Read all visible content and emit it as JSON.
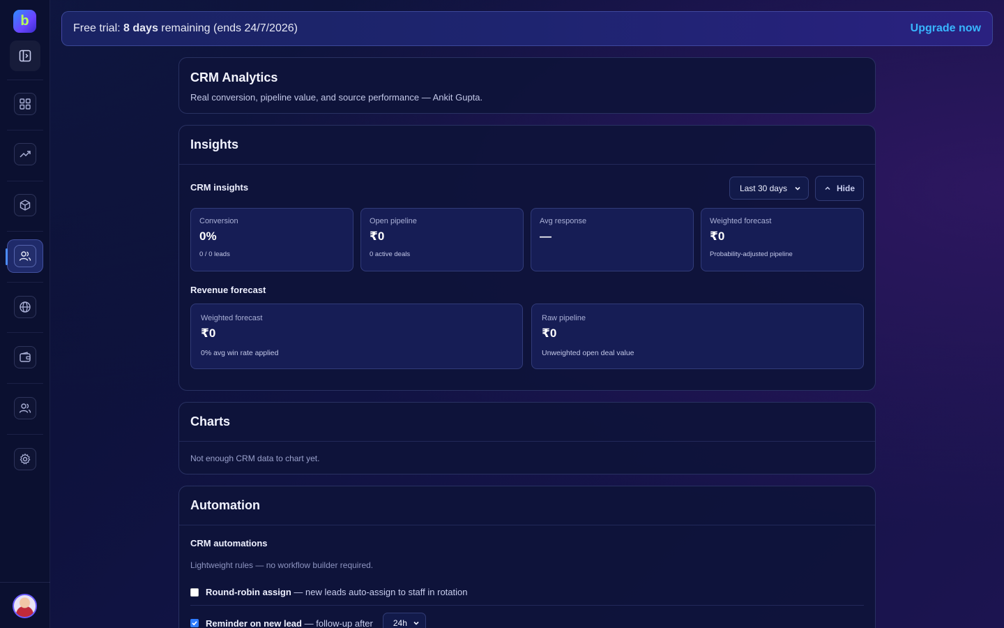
{
  "sidebar": {
    "logo_letter": "b",
    "items": [
      {
        "icon": "grid-icon"
      },
      {
        "icon": "trending-up-icon"
      },
      {
        "icon": "box-icon"
      },
      {
        "icon": "users-icon",
        "active": true
      },
      {
        "icon": "globe-icon"
      },
      {
        "icon": "wallet-icon"
      },
      {
        "icon": "team-icon"
      },
      {
        "icon": "gear-icon"
      }
    ]
  },
  "trial": {
    "prefix": "Free trial:",
    "days": "8 days",
    "suffix": "remaining (ends 24/7/2026)",
    "upgrade_label": "Upgrade now"
  },
  "header": {
    "title": "CRM Analytics",
    "subtitle": "Real conversion, pipeline value, and source performance — Ankit Gupta."
  },
  "insights": {
    "section_title": "Insights",
    "sub_title": "CRM insights",
    "range_select": "Last 30 days",
    "hide_label": "Hide",
    "stats": [
      {
        "label": "Conversion",
        "value": "0%",
        "note": "0 / 0 leads"
      },
      {
        "label": "Open pipeline",
        "value": "₹0",
        "note": "0 active deals"
      },
      {
        "label": "Avg response",
        "value": "—",
        "note": ""
      },
      {
        "label": "Weighted forecast",
        "value": "₹0",
        "note": "Probability-adjusted pipeline"
      }
    ],
    "revenue_title": "Revenue forecast",
    "revenue": [
      {
        "label": "Weighted forecast",
        "value": "₹0",
        "note": "0% avg win rate applied"
      },
      {
        "label": "Raw pipeline",
        "value": "₹0",
        "note": "Unweighted open deal value"
      }
    ]
  },
  "charts": {
    "section_title": "Charts",
    "empty_text": "Not enough CRM data to chart yet."
  },
  "automation": {
    "section_title": "Automation",
    "sub_title": "CRM automations",
    "description": "Lightweight rules — no workflow builder required.",
    "rules": [
      {
        "name": "Round-robin assign",
        "detail": "— new leads auto-assign to staff in rotation",
        "checked": false
      },
      {
        "name": "Reminder on new lead",
        "detail": "— follow-up after",
        "checked": true,
        "select": "24h"
      }
    ]
  }
}
